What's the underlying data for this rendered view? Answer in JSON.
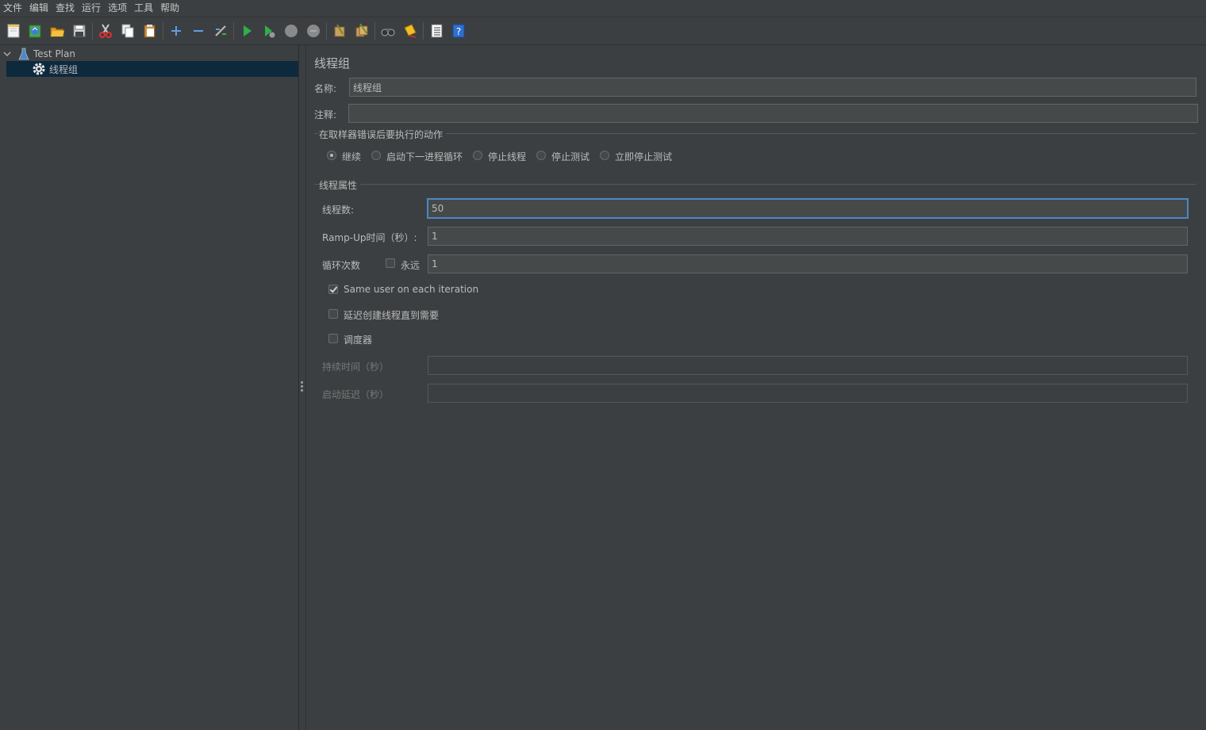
{
  "menu": [
    "文件",
    "编辑",
    "查找",
    "运行",
    "选项",
    "工具",
    "帮助"
  ],
  "tree": {
    "root_label": "Test Plan",
    "child_label": "线程组"
  },
  "panel": {
    "title": "线程组",
    "name_label": "名称:",
    "name_value": "线程组",
    "comment_label": "注释:",
    "comment_value": "",
    "error_group_title": "在取样器错误后要执行的动作",
    "error_actions": [
      {
        "label": "继续",
        "selected": true
      },
      {
        "label": "启动下一进程循环",
        "selected": false
      },
      {
        "label": "停止线程",
        "selected": false
      },
      {
        "label": "停止测试",
        "selected": false
      },
      {
        "label": "立即停止测试",
        "selected": false
      }
    ],
    "thread_group_title": "线程属性",
    "threads_label": "线程数:",
    "threads_value": "50",
    "rampup_label": "Ramp-Up时间（秒）:",
    "rampup_value": "1",
    "loop_label": "循环次数",
    "forever_label": "永远",
    "forever_checked": false,
    "loop_value": "1",
    "same_user_label": "Same user on each iteration",
    "same_user_checked": true,
    "delay_label": "延迟创建线程直到需要",
    "delay_checked": false,
    "scheduler_label": "调度器",
    "scheduler_checked": false,
    "duration_label": "持续时间（秒）",
    "duration_value": "",
    "startup_delay_label": "启动延迟（秒）",
    "startup_delay_value": ""
  },
  "icons": [
    "new-icon",
    "templates-icon",
    "open-icon",
    "save-icon",
    "cut-icon",
    "copy-icon",
    "paste-icon",
    "expand-icon",
    "collapse-icon",
    "toggle-icon",
    "start-icon",
    "start-no-pause-icon",
    "stop-icon",
    "shutdown-icon",
    "clear-icon",
    "clear-all-icon",
    "search-icon",
    "reset-search-icon",
    "function-helper-icon",
    "help-icon"
  ]
}
